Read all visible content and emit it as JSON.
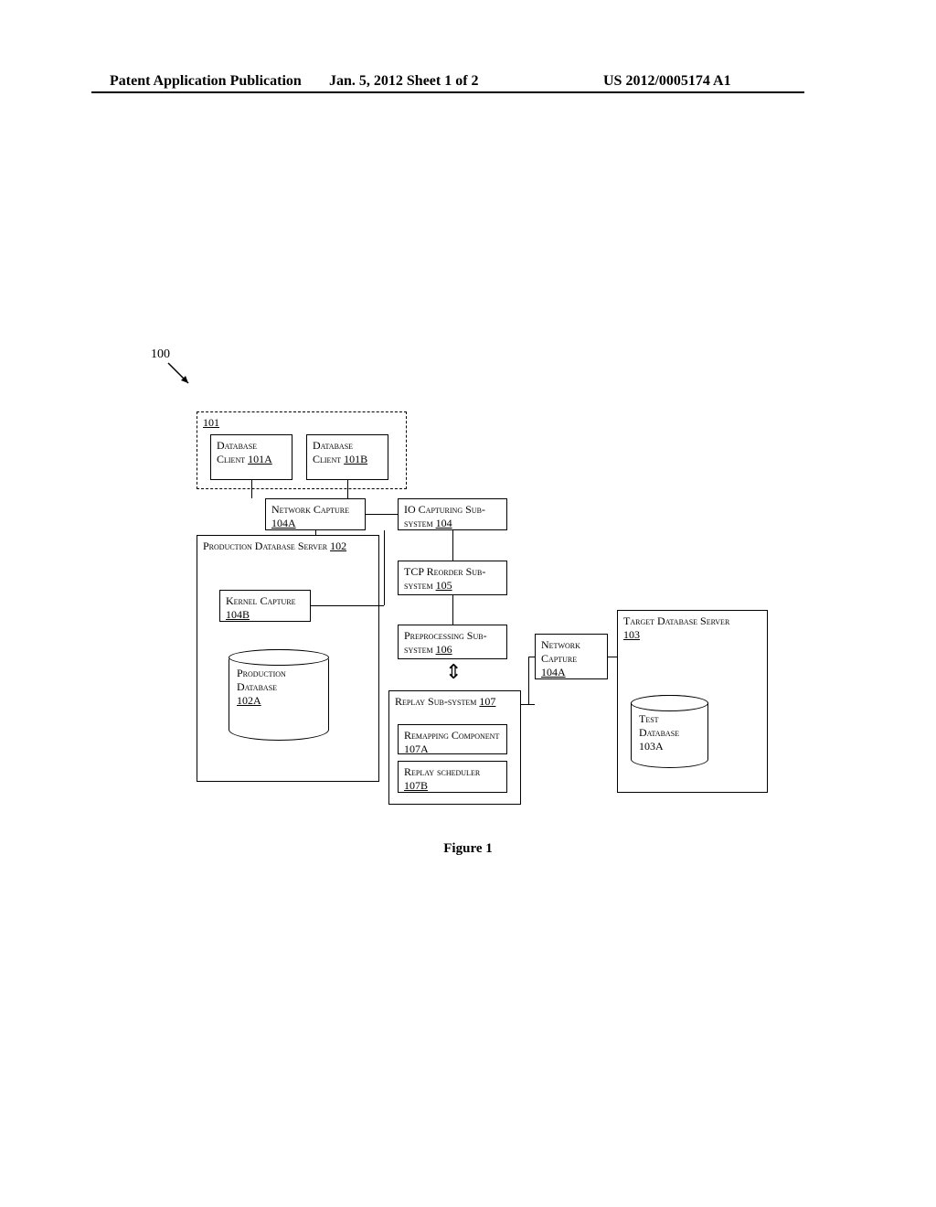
{
  "header": {
    "left": "Patent Application Publication",
    "center": "Jan. 5, 2012   Sheet 1 of 2",
    "right": "US 2012/0005174 A1"
  },
  "diagram": {
    "systemRef": "100",
    "clientsGroupRef": "101",
    "clientA": {
      "label": "Database Client ",
      "ref": "101A"
    },
    "clientB": {
      "label": "Database Client ",
      "ref": "101B"
    },
    "netCapture": {
      "label": "Network Capture ",
      "ref": "104A"
    },
    "ioCapture": {
      "label": "IO Capturing Sub-system ",
      "ref": "104"
    },
    "prodServer": {
      "label": "Production Database Server ",
      "ref": "102"
    },
    "kernelCapture": {
      "label": "Kernel Capture ",
      "ref": "104B"
    },
    "prodDb": {
      "label": "Production Database ",
      "ref": "102A"
    },
    "tcpReorder": {
      "label": "TCP Reorder Sub-system ",
      "ref": "105"
    },
    "preproc": {
      "label": "Preprocessing Sub-system ",
      "ref": "106"
    },
    "replay": {
      "label": "Replay Sub-system ",
      "ref": "107"
    },
    "remap": {
      "label": "Remapping Component ",
      "ref": "107A"
    },
    "resched": {
      "label": "Replay scheduler ",
      "ref": "107B"
    },
    "netCapture2": {
      "label": "Network Capture ",
      "ref": "104A"
    },
    "targetServer": {
      "label": "Target Database Server ",
      "ref": "103"
    },
    "testDb": {
      "label": "Test Database ",
      "ref": "103A"
    }
  },
  "caption": "Figure 1"
}
